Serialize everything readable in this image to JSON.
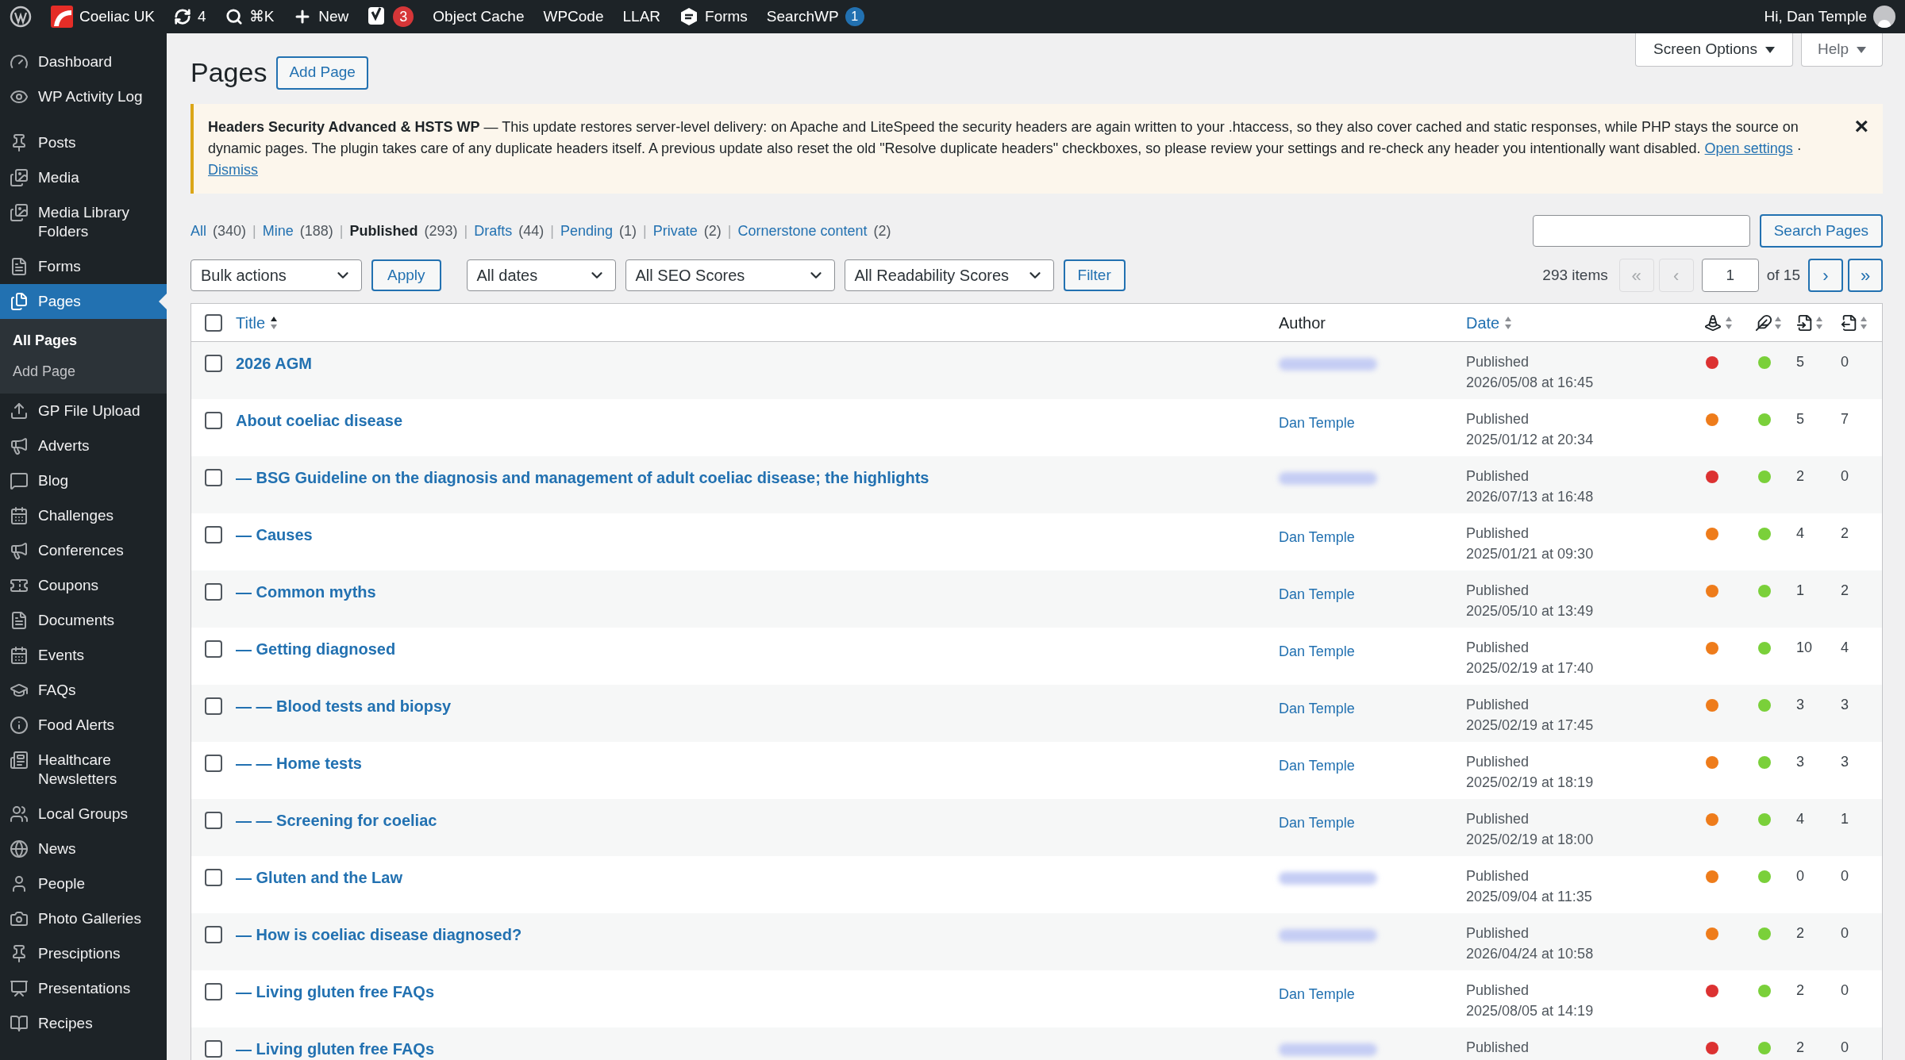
{
  "admin_bar": {
    "site": "Coeliac UK",
    "updates": "4",
    "search_shortcut": "⌘K",
    "new": "New",
    "yoast_badge": "3",
    "links": [
      "Object Cache",
      "WPCode",
      "LLAR"
    ],
    "forms": "Forms",
    "searchwp": "SearchWP",
    "searchwp_badge": "1",
    "greeting": "Hi, Dan Temple"
  },
  "sidebar": {
    "sections": [
      {
        "items": [
          {
            "label": "Dashboard",
            "selected": false
          },
          {
            "label": "WP Activity Log",
            "selected": false
          }
        ]
      },
      {
        "items": [
          {
            "label": "Posts",
            "selected": false
          },
          {
            "label": "Media",
            "selected": false
          },
          {
            "label": "Media Library Folders",
            "selected": false
          },
          {
            "label": "Forms",
            "selected": false
          },
          {
            "label": "Pages",
            "selected": true,
            "children": [
              {
                "label": "All Pages",
                "selected": true
              },
              {
                "label": "Add Page",
                "selected": false
              }
            ]
          },
          {
            "label": "GP File Upload",
            "selected": false
          },
          {
            "label": "Adverts",
            "selected": false
          },
          {
            "label": "Blog",
            "selected": false
          },
          {
            "label": "Challenges",
            "selected": false
          },
          {
            "label": "Conferences",
            "selected": false
          },
          {
            "label": "Coupons",
            "selected": false
          },
          {
            "label": "Documents",
            "selected": false
          },
          {
            "label": "Events",
            "selected": false
          },
          {
            "label": "FAQs",
            "selected": false
          },
          {
            "label": "Food Alerts",
            "selected": false
          },
          {
            "label": "Healthcare Newsletters",
            "selected": false
          },
          {
            "label": "Local Groups",
            "selected": false
          },
          {
            "label": "News",
            "selected": false
          },
          {
            "label": "People",
            "selected": false
          },
          {
            "label": "Photo Galleries",
            "selected": false
          },
          {
            "label": "Presciptions",
            "selected": false
          },
          {
            "label": "Presentations",
            "selected": false
          },
          {
            "label": "Recipes",
            "selected": false
          }
        ]
      }
    ]
  },
  "header": {
    "title": "Pages",
    "add_button": "Add Page",
    "screen_options": "Screen Options",
    "help": "Help"
  },
  "notice": {
    "title": "Headers Security Advanced & HSTS WP",
    "text": " — This update restores server-level delivery: on Apache and LiteSpeed the security headers are again written to your .htaccess, so they also cover cached and static responses, while PHP stays the source on dynamic pages. The plugin takes care of any duplicate headers itself. A previous update also reset the old \"Resolve duplicate headers\" checkboxes, so please review your settings and re-check any header you intentionally want disabled.",
    "link": "Open settings",
    "separator": "·",
    "dismiss": "Dismiss",
    "close": "×"
  },
  "view_separator": "|",
  "views": [
    {
      "label": "All",
      "count": "(340)",
      "selected": false
    },
    {
      "label": "Mine",
      "count": "(188)",
      "selected": false
    },
    {
      "label": "Published",
      "count": "(293)",
      "selected": true
    },
    {
      "label": "Drafts",
      "count": "(44)",
      "selected": false
    },
    {
      "label": "Pending",
      "count": "(1)",
      "selected": false
    },
    {
      "label": "Private",
      "count": "(2)",
      "selected": false
    },
    {
      "label": "Cornerstone content",
      "count": "(2)",
      "selected": false
    }
  ],
  "search_button": "Search Pages",
  "filters": {
    "bulk": "Bulk actions",
    "apply": "Apply",
    "dates": "All dates",
    "seo": "All SEO Scores",
    "readability": "All Readability Scores",
    "filter": "Filter"
  },
  "pagination": {
    "items": "293 items",
    "first": "«",
    "prev": "‹",
    "page": "1",
    "of": "of 15",
    "next": "›",
    "last": "»"
  },
  "table": {
    "select_all_checked": false,
    "columns": [
      "Title",
      "Author",
      "Date"
    ],
    "rows": [
      {
        "title": "2026 AGM",
        "author": null,
        "status": "Published",
        "date": "2026/05/08 at 16:45",
        "dots": [
          {
            "color": "#dc3232"
          },
          {
            "color": "#7ad03a"
          }
        ],
        "links_in": "5",
        "links_out": "0",
        "checked": false
      },
      {
        "title": "About coeliac disease",
        "author": "Dan Temple",
        "status": "Published",
        "date": "2025/01/12 at 20:34",
        "dots": [
          {
            "color": "#ee7c1b"
          },
          {
            "color": "#7ad03a"
          }
        ],
        "links_in": "5",
        "links_out": "7",
        "checked": false
      },
      {
        "title": "— BSG Guideline on the diagnosis and management of adult coeliac disease; the highlights",
        "author": null,
        "status": "Published",
        "date": "2026/07/13 at 16:48",
        "dots": [
          {
            "color": "#dc3232"
          },
          {
            "color": "#7ad03a"
          }
        ],
        "links_in": "2",
        "links_out": "0",
        "checked": false
      },
      {
        "title": "— Causes",
        "author": "Dan Temple",
        "status": "Published",
        "date": "2025/01/21 at 09:30",
        "dots": [
          {
            "color": "#ee7c1b"
          },
          {
            "color": "#7ad03a"
          }
        ],
        "links_in": "4",
        "links_out": "2",
        "checked": false
      },
      {
        "title": "— Common myths",
        "author": "Dan Temple",
        "status": "Published",
        "date": "2025/05/10 at 13:49",
        "dots": [
          {
            "color": "#ee7c1b"
          },
          {
            "color": "#7ad03a"
          }
        ],
        "links_in": "1",
        "links_out": "2",
        "checked": false
      },
      {
        "title": "— Getting diagnosed",
        "author": "Dan Temple",
        "status": "Published",
        "date": "2025/02/19 at 17:40",
        "dots": [
          {
            "color": "#ee7c1b"
          },
          {
            "color": "#7ad03a"
          }
        ],
        "links_in": "10",
        "links_out": "4",
        "checked": false
      },
      {
        "title": "— — Blood tests and biopsy",
        "author": "Dan Temple",
        "status": "Published",
        "date": "2025/02/19 at 17:45",
        "dots": [
          {
            "color": "#ee7c1b"
          },
          {
            "color": "#7ad03a"
          }
        ],
        "links_in": "3",
        "links_out": "3",
        "checked": false
      },
      {
        "title": "— — Home tests",
        "author": "Dan Temple",
        "status": "Published",
        "date": "2025/02/19 at 18:19",
        "dots": [
          {
            "color": "#ee7c1b"
          },
          {
            "color": "#7ad03a"
          }
        ],
        "links_in": "3",
        "links_out": "3",
        "checked": false
      },
      {
        "title": "— — Screening for coeliac",
        "author": "Dan Temple",
        "status": "Published",
        "date": "2025/02/19 at 18:00",
        "dots": [
          {
            "color": "#ee7c1b"
          },
          {
            "color": "#7ad03a"
          }
        ],
        "links_in": "4",
        "links_out": "1",
        "checked": false
      },
      {
        "title": "— Gluten and the Law",
        "author": null,
        "status": "Published",
        "date": "2025/09/04 at 11:35",
        "dots": [
          {
            "color": "#ee7c1b"
          },
          {
            "color": "#7ad03a"
          }
        ],
        "links_in": "0",
        "links_out": "0",
        "checked": false
      },
      {
        "title": "— How is coeliac disease diagnosed?",
        "author": null,
        "status": "Published",
        "date": "2026/04/24 at 10:58",
        "dots": [
          {
            "color": "#ee7c1b"
          },
          {
            "color": "#7ad03a"
          }
        ],
        "links_in": "2",
        "links_out": "0",
        "checked": false
      },
      {
        "title": "— Living gluten free FAQs",
        "author": "Dan Temple",
        "status": "Published",
        "date": "2025/08/05 at 14:19",
        "dots": [
          {
            "color": "#dc3232"
          },
          {
            "color": "#7ad03a"
          }
        ],
        "links_in": "2",
        "links_out": "0",
        "checked": false
      },
      {
        "title": "— Living gluten free FAQs",
        "author": null,
        "status": "Published",
        "dots": [
          {
            "color": "#dc3232"
          },
          {
            "color": "#7ad03a"
          }
        ],
        "links_in": "2",
        "links_out": "0",
        "checked": false
      }
    ]
  }
}
